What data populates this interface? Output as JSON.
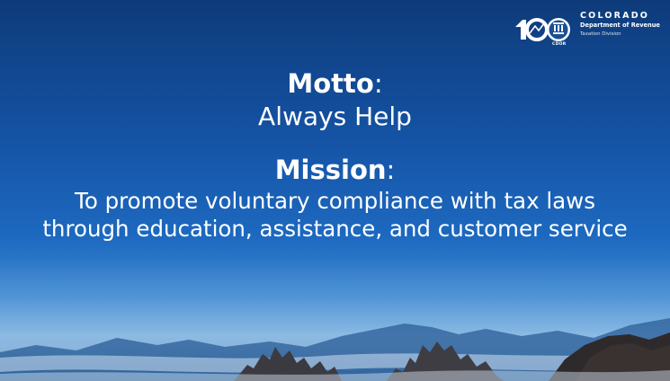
{
  "logo": {
    "state": "COLORADO",
    "department": "Department of Revenue",
    "division": "Taxation Division",
    "badge_text": "CDOR",
    "icon": "colorado-100-logo-icon"
  },
  "motto": {
    "label": "Motto",
    "separator": ":",
    "text": "Always Help"
  },
  "mission": {
    "label": "Mission",
    "separator": ":",
    "line1": "To promote voluntary compliance with tax laws",
    "line2": "through education, assistance, and customer service"
  },
  "colors": {
    "background_top": "#0e3b7a",
    "background_mid": "#1d69c0",
    "text": "#ffffff"
  }
}
